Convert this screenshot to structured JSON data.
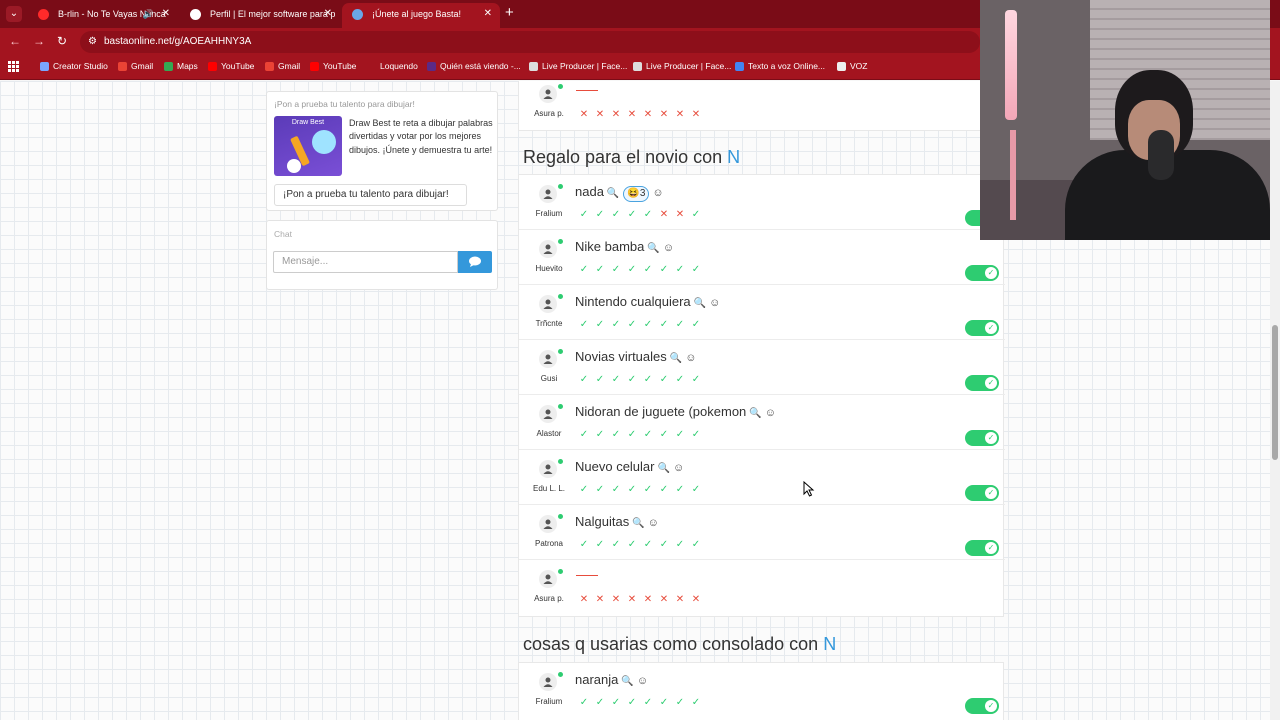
{
  "browser": {
    "tabs": [
      {
        "title": "B-rlin - No Te Vayas Nunca",
        "color": "#ff2a2a"
      },
      {
        "title": "Perfil | El mejor software para p",
        "color": "#ffffff"
      },
      {
        "title": "¡Únete al juego Basta!",
        "color": "#6aa7e8"
      }
    ],
    "url": "bastaonline.net/g/AOEAHHNY3A",
    "bookmarks": [
      {
        "label": "Creator Studio",
        "color": "#7aa6ff"
      },
      {
        "label": "Gmail",
        "color": "#ea4335"
      },
      {
        "label": "Maps",
        "color": "#34a853"
      },
      {
        "label": "YouTube",
        "color": "#ff0000"
      },
      {
        "label": "Gmail",
        "color": "#ea4335"
      },
      {
        "label": "YouTube",
        "color": "#ff0000"
      },
      {
        "label": "Loquendo",
        "color": "#a3141f"
      },
      {
        "label": "Quién está viendo -...",
        "color": "#5b2a86"
      },
      {
        "label": "Live Producer | Face...",
        "color": "#dddddd"
      },
      {
        "label": "Live Producer | Face...",
        "color": "#dddddd"
      },
      {
        "label": "Texto a voz Online...",
        "color": "#4285f4"
      },
      {
        "label": "VOZ",
        "color": "#eeeeee"
      }
    ]
  },
  "promo": {
    "title": "¡Pon a prueba tu talento para dibujar!",
    "image_label": "Draw Best",
    "text": "Draw Best te reta a dibujar palabras divertidas y votar por los mejores dibujos. ¡Únete y demuestra tu arte!",
    "button": "¡Pon a prueba tu talento para dibujar!"
  },
  "chat": {
    "title": "Chat",
    "placeholder": "Mensaje..."
  },
  "top_row": {
    "user": "Asura p.",
    "votes": [
      "no",
      "no",
      "no",
      "no",
      "no",
      "no",
      "no",
      "no"
    ]
  },
  "categories": [
    {
      "title": "Regalo para el novio con",
      "letter": "N",
      "rows": [
        {
          "answer": "nada",
          "user": "Fralium",
          "emoji": "😆3",
          "votes": [
            "ok",
            "ok",
            "ok",
            "ok",
            "ok",
            "no",
            "no",
            "ok"
          ]
        },
        {
          "answer": "Nike bamba",
          "user": "Huevito",
          "votes": [
            "ok",
            "ok",
            "ok",
            "ok",
            "ok",
            "ok",
            "ok",
            "ok"
          ]
        },
        {
          "answer": "Nintendo cualquiera",
          "user": "Trñcnte",
          "votes": [
            "ok",
            "ok",
            "ok",
            "ok",
            "ok",
            "ok",
            "ok",
            "ok"
          ]
        },
        {
          "answer": "Novias virtuales",
          "user": "Gusi",
          "votes": [
            "ok",
            "ok",
            "ok",
            "ok",
            "ok",
            "ok",
            "ok",
            "ok"
          ]
        },
        {
          "answer": "Nidoran de juguete (pokemon",
          "user": "Alastor",
          "votes": [
            "ok",
            "ok",
            "ok",
            "ok",
            "ok",
            "ok",
            "ok",
            "ok"
          ]
        },
        {
          "answer": "Nuevo celular",
          "user": "Edu L. L.",
          "votes": [
            "ok",
            "ok",
            "ok",
            "ok",
            "ok",
            "ok",
            "ok",
            "ok"
          ]
        },
        {
          "answer": "Nalguitas",
          "user": "Patrona",
          "votes": [
            "ok",
            "ok",
            "ok",
            "ok",
            "ok",
            "ok",
            "ok",
            "ok"
          ]
        },
        {
          "answer": "",
          "user": "Asura p.",
          "votes": [
            "no",
            "no",
            "no",
            "no",
            "no",
            "no",
            "no",
            "no"
          ]
        }
      ]
    },
    {
      "title": "cosas q usarias como consolado con",
      "letter": "N",
      "rows": [
        {
          "answer": "naranja",
          "user": "Fralium",
          "votes": [
            "ok",
            "ok",
            "ok",
            "ok",
            "ok",
            "ok",
            "ok",
            "ok"
          ]
        }
      ]
    }
  ]
}
